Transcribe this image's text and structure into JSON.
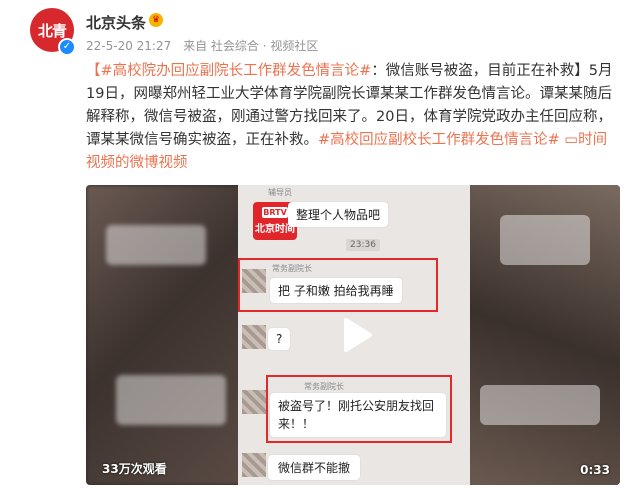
{
  "author": {
    "avatar_text": "北青",
    "name": "北京头条",
    "badge_icon": "crown-icon",
    "verified_icon": "verified-icon"
  },
  "meta": {
    "time": "22-5-20 21:27",
    "source": "来自 社会综合 · 视频社区"
  },
  "post": {
    "tag1": "【#高校院办回应副院长工作群发色情言论#",
    "text1": "：微信账号被盗，目前正在补救】5月19日，网曝郑州轻工业大学体育学院副院长谭某某工作群发色情言论。谭某某随后解释称，微信号被盗，刚通过警方找回来了。20日，体育学院党政办主任回应称，谭某某微信号确实被盗，正在补救。",
    "tag2": "#高校回应副校长工作群发色情言论#",
    "link_icon": "video-link-icon",
    "link_text": "时间视频的微博视频"
  },
  "video": {
    "logo_top": "BRTV",
    "logo_text": "北京时间",
    "chat": {
      "label_top": "辅导员",
      "bubble_top": "整理个人物品吧",
      "time": "23:36",
      "label_vp1": "常务副院长",
      "bubble_vp1": "把  子和嫩  拍给我再睡",
      "bubble_q": "?",
      "label_vp2": "常务副院长",
      "bubble_vp2": "被盗号了！刚托公安朋友找回来！！",
      "bubble_last": "微信群不能撤"
    },
    "views": "33万次观看",
    "duration": "0:33",
    "play_icon": "play-icon"
  }
}
